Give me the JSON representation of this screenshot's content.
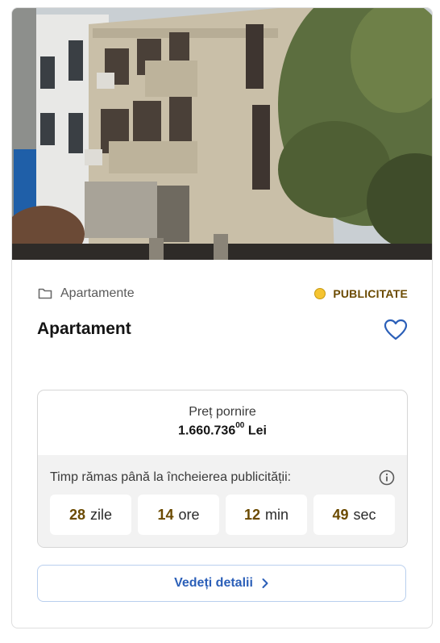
{
  "listing": {
    "photo_alt": "listing-photo",
    "category": "Apartamente",
    "status": "PUBLICITATE",
    "title": "Apartament"
  },
  "price": {
    "label": "Preț pornire",
    "amount": "1.660.736",
    "decimals": "00",
    "currency": "Lei"
  },
  "timer": {
    "label": "Timp rămas până la încheierea publicității:",
    "cells": [
      {
        "value": "28",
        "unit": "zile"
      },
      {
        "value": "14",
        "unit": "ore"
      },
      {
        "value": "12",
        "unit": "min"
      },
      {
        "value": "49",
        "unit": "sec"
      }
    ]
  },
  "actions": {
    "details_label": "Vedeți detalii"
  },
  "colors": {
    "accent": "#2b5fb8",
    "status_dot": "#f5c431",
    "status_text": "#6b4a00"
  }
}
